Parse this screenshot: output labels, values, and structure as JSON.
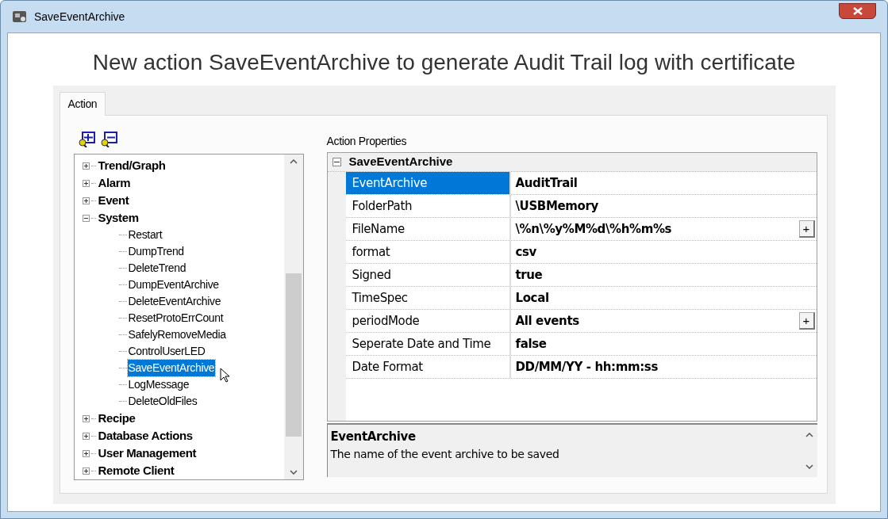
{
  "window": {
    "title": "SaveEventArchive"
  },
  "heading": "New action SaveEventArchive to generate Audit Trail log with certificate",
  "tabs": [
    {
      "label": "Action",
      "selected": true
    }
  ],
  "tree": [
    {
      "label": "Trend/Graph",
      "expanded": false,
      "selected": false
    },
    {
      "label": "Alarm",
      "expanded": false,
      "selected": false
    },
    {
      "label": "Event",
      "expanded": false,
      "selected": false
    },
    {
      "label": "System",
      "expanded": true,
      "selected": false,
      "children": [
        {
          "label": "Restart",
          "selected": false
        },
        {
          "label": "DumpTrend",
          "selected": false
        },
        {
          "label": "DeleteTrend",
          "selected": false
        },
        {
          "label": "DumpEventArchive",
          "selected": false
        },
        {
          "label": "DeleteEventArchive",
          "selected": false
        },
        {
          "label": "ResetProtoErrCount",
          "selected": false
        },
        {
          "label": "SafelyRemoveMedia",
          "selected": false
        },
        {
          "label": "ControlUserLED",
          "selected": false
        },
        {
          "label": "SaveEventArchive",
          "selected": true
        },
        {
          "label": "LogMessage",
          "selected": false
        },
        {
          "label": "DeleteOldFiles",
          "selected": false
        }
      ]
    },
    {
      "label": "Recipe",
      "expanded": false,
      "selected": false
    },
    {
      "label": "Database Actions",
      "expanded": false,
      "selected": false
    },
    {
      "label": "User Management",
      "expanded": false,
      "selected": false
    },
    {
      "label": "Remote Client",
      "expanded": false,
      "selected": false
    }
  ],
  "properties": {
    "label": "Action Properties",
    "category": "SaveEventArchive",
    "expanded": true,
    "rows": [
      {
        "name": "EventArchive",
        "value": "AuditTrail",
        "selected": true
      },
      {
        "name": "FolderPath",
        "value": "\\USBMemory",
        "selected": false
      },
      {
        "name": "FileName",
        "value": "\\%n\\%y%M%d\\%h%m%s",
        "selected": false,
        "button": "+"
      },
      {
        "name": "format",
        "value": "csv",
        "selected": false
      },
      {
        "name": "Signed",
        "value": "true",
        "selected": false
      },
      {
        "name": "TimeSpec",
        "value": "Local",
        "selected": false
      },
      {
        "name": "periodMode",
        "value": "All events",
        "selected": false,
        "button": "+"
      },
      {
        "name": "Seperate Date and Time",
        "value": "false",
        "selected": false
      },
      {
        "name": "Date Format",
        "value": "DD/MM/YY - hh:mm:ss",
        "selected": false
      }
    ]
  },
  "description": {
    "title": "EventArchive",
    "text": "The name of the event archive to be saved"
  }
}
